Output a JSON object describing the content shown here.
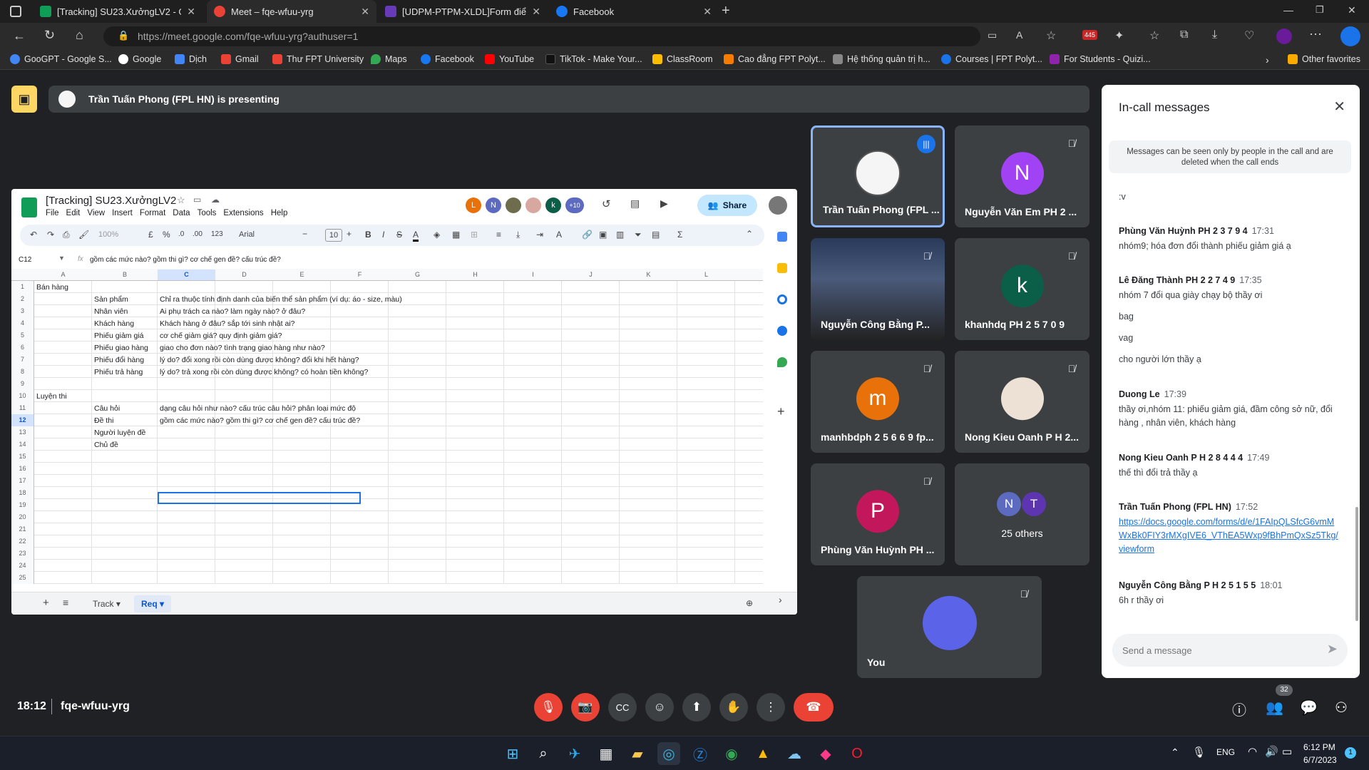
{
  "browser": {
    "tabs": [
      {
        "title": "[Tracking] SU23.XưởngLV2 - Goo",
        "color": "#0f9d58"
      },
      {
        "title": "Meet – fqe-wfuu-yrg",
        "color": "#ea4335"
      },
      {
        "title": "[UDPM-PTPM-XLDL]Form điểm d",
        "color": "#673ab7"
      },
      {
        "title": "Facebook",
        "color": "#1877f2"
      }
    ],
    "url": "https://meet.google.com/fqe-wfuu-yrg?authuser=1",
    "badge": "445",
    "bookmarks": [
      "GooGPT - Google S...",
      "Google",
      "Dịch",
      "Gmail",
      "Thư FPT University",
      "Maps",
      "Facebook",
      "YouTube",
      "TikTok - Make Your...",
      "ClassRoom",
      "Cao đẳng FPT Polyt...",
      "Hệ thống quản trị h...",
      "Courses | FPT Polyt...",
      "For Students - Quizi..."
    ],
    "other_favorites": "Other favorites"
  },
  "meet": {
    "presenting": "Trần Tuấn Phong (FPL HN) is presenting",
    "time": "18:12",
    "code": "fqe-wfuu-yrg",
    "people_count": "32",
    "participants": [
      {
        "name": "Trần Tuấn Phong (FPL ...",
        "initial": "",
        "color": "#fff"
      },
      {
        "name": "Nguyễn Văn Em PH 2 ...",
        "initial": "N",
        "color": "#a142f4"
      },
      {
        "name": "Nguyễn Công Bằng P...",
        "initial": "",
        "color": "#333"
      },
      {
        "name": "khanhdq PH 2 5 7 0 9",
        "initial": "k",
        "color": "#0b5e47"
      },
      {
        "name": "manhbdph 2 5 6 6 9 fp...",
        "initial": "m",
        "color": "#e8710a"
      },
      {
        "name": "Nong Kieu Oanh P H 2...",
        "initial": "",
        "color": "#ddd"
      },
      {
        "name": "Phùng Văn Huỳnh PH ...",
        "initial": "P",
        "color": "#c2185b"
      },
      {
        "name": "25 others",
        "initial": "",
        "color": ""
      },
      {
        "name": "You",
        "initial": "",
        "color": "#5b63e8"
      }
    ],
    "others_initials": [
      "N",
      "T"
    ]
  },
  "sheet": {
    "title": "[Tracking] SU23.XưởngLV2",
    "menu": [
      "File",
      "Edit",
      "View",
      "Insert",
      "Format",
      "Data",
      "Tools",
      "Extensions",
      "Help"
    ],
    "share": "Share",
    "more_count": "+10",
    "zoom": "100%",
    "font": "Arial",
    "font_size": "10",
    "cell_ref": "C12",
    "formula": "gồm các mức nào? gồm thi gì? cơ chế gen đề? cấu trúc đề?",
    "columns": [
      "A",
      "B",
      "C",
      "D",
      "E",
      "F",
      "G",
      "H",
      "I",
      "J",
      "K",
      "L"
    ],
    "rows": [
      {
        "n": "1",
        "a": "Bán hàng",
        "b": "",
        "c": ""
      },
      {
        "n": "2",
        "a": "",
        "b": "Sản phẩm",
        "c": "Chỉ ra thuộc tính định danh của biến thể sản phẩm (ví dụ: áo - size, màu)"
      },
      {
        "n": "3",
        "a": "",
        "b": "Nhân viên",
        "c": "Ai phụ trách ca nào? làm ngày nào? ở đâu?"
      },
      {
        "n": "4",
        "a": "",
        "b": "Khách hàng",
        "c": "Khách hàng ở đâu? sắp tới sinh nhật ai?"
      },
      {
        "n": "5",
        "a": "",
        "b": "Phiếu giảm giá",
        "c": "cơ chế giảm giá? quy định giảm giá?"
      },
      {
        "n": "6",
        "a": "",
        "b": "Phiếu giao hàng",
        "c": "giao cho đơn nào? tình trạng giao hàng như nào?"
      },
      {
        "n": "7",
        "a": "",
        "b": "Phiếu đổi hàng",
        "c": "lý do? đổi xong rồi còn dùng được không? đổi khi hết hàng?"
      },
      {
        "n": "8",
        "a": "",
        "b": "Phiếu trả hàng",
        "c": "lý do? trả xong rồi còn dùng được không? có hoàn tiền không?"
      },
      {
        "n": "9",
        "a": "",
        "b": "",
        "c": ""
      },
      {
        "n": "10",
        "a": "Luyện thi",
        "b": "",
        "c": ""
      },
      {
        "n": "11",
        "a": "",
        "b": "Câu hỏi",
        "c": "dạng câu hỏi như nào? cấu trúc câu hỏi? phân loại mức độ"
      },
      {
        "n": "12",
        "a": "",
        "b": "Đề thi",
        "c": "gồm các mức nào? gồm thi gì? cơ chế gen đề? cấu trúc đề?"
      },
      {
        "n": "13",
        "a": "",
        "b": "Người luyện đề",
        "c": ""
      },
      {
        "n": "14",
        "a": "",
        "b": "Chủ đề",
        "c": ""
      },
      {
        "n": "15",
        "a": "",
        "b": "",
        "c": ""
      },
      {
        "n": "16",
        "a": "",
        "b": "",
        "c": ""
      },
      {
        "n": "17",
        "a": "",
        "b": "",
        "c": ""
      },
      {
        "n": "18",
        "a": "",
        "b": "",
        "c": ""
      },
      {
        "n": "19",
        "a": "",
        "b": "",
        "c": ""
      },
      {
        "n": "20",
        "a": "",
        "b": "",
        "c": ""
      },
      {
        "n": "21",
        "a": "",
        "b": "",
        "c": ""
      },
      {
        "n": "22",
        "a": "",
        "b": "",
        "c": ""
      },
      {
        "n": "23",
        "a": "",
        "b": "",
        "c": ""
      },
      {
        "n": "24",
        "a": "",
        "b": "",
        "c": ""
      },
      {
        "n": "25",
        "a": "",
        "b": "",
        "c": ""
      }
    ],
    "sheet_tabs": [
      "Track",
      "Req"
    ],
    "active_tab": "Req"
  },
  "messages": {
    "title": "In-call messages",
    "notice": "Messages can be seen only by people in the call and are deleted when the call ends",
    "items": [
      {
        "who": "",
        "time": "",
        "lines": [
          ":v"
        ]
      },
      {
        "who": "Phùng Văn Huỳnh PH 2 3 7 9 4",
        "time": "17:31",
        "lines": [
          "nhóm9; hóa đơn đổi thành phiếu giảm giá ạ"
        ]
      },
      {
        "who": "Lê Đăng Thành PH 2 2 7 4 9",
        "time": "17:35",
        "lines": [
          "nhóm 7 đổi qua giày chạy bộ thầy ơi",
          "bag",
          "vag",
          "cho người lớn thầy ạ"
        ]
      },
      {
        "who": "Duong Le",
        "time": "17:39",
        "lines": [
          "thầy ơi,nhóm 11: phiếu giảm giá, đầm công sở nữ, đổi hàng , nhân viên, khách hàng"
        ]
      },
      {
        "who": "Nong Kieu Oanh P H 2 8 4 4 4",
        "time": "17:49",
        "lines": [
          "thế thì đổi trả thầy ạ"
        ]
      },
      {
        "who": "Trần Tuấn Phong (FPL HN)",
        "time": "17:52",
        "lines": [
          "https://docs.google.com/forms/d/e/1FAIpQLSfcG6vmMWxBk0FIY3rMXgIVE6_VThEA5Wxp9fBhPmQxSz5Tkg/viewform"
        ]
      },
      {
        "who": "Nguyễn Công Bằng P H 2 5 1 5 5",
        "time": "18:01",
        "lines": [
          "6h r thầy ơi"
        ]
      }
    ],
    "placeholder": "Send a message"
  },
  "taskbar": {
    "lang": "ENG",
    "time": "6:12 PM",
    "date": "6/7/2023",
    "notif": "1"
  }
}
